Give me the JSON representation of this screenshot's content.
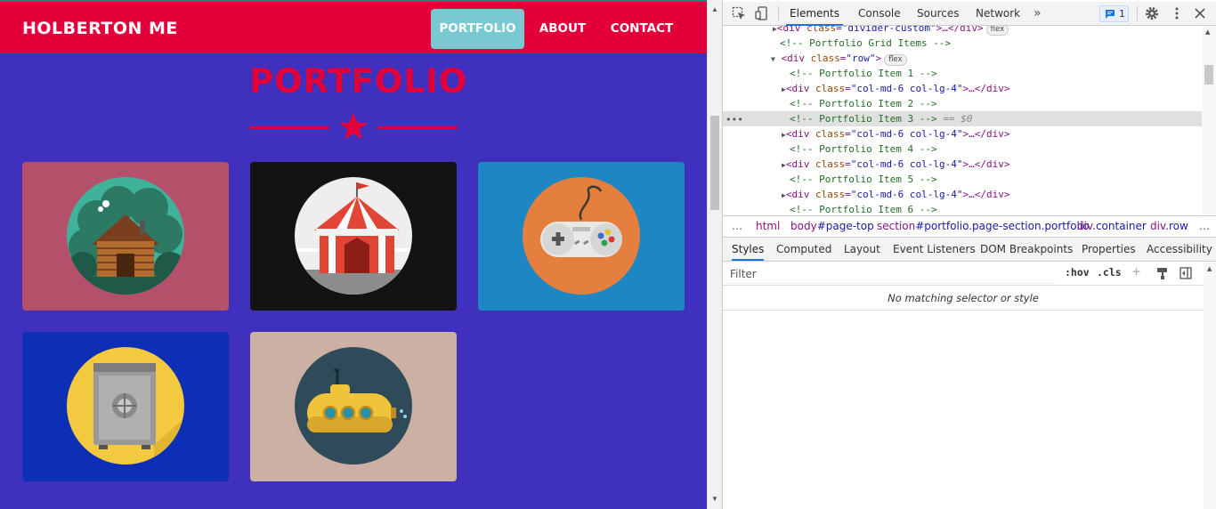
{
  "page": {
    "brand": "HOLBERTON ME",
    "nav": {
      "portfolio": "PORTFOLIO",
      "about": "ABOUT",
      "contact": "CONTACT"
    },
    "section_heading": "PORTFOLIO",
    "portfolio_items": [
      {
        "icon": "cabin-icon",
        "bg": "#b5506a"
      },
      {
        "icon": "circus-tent-icon",
        "bg": "#151212"
      },
      {
        "icon": "game-controller-icon",
        "bg": "#1f86c4"
      },
      {
        "icon": "safe-icon",
        "bg": "#0c2fb5"
      },
      {
        "icon": "submarine-icon",
        "bg": "#ccb0a3"
      }
    ],
    "colors": {
      "primary": "#e3003a",
      "page_bg": "#3f31be",
      "active_nav": "#79c9d3"
    }
  },
  "devtools": {
    "tabs": {
      "elements": "Elements",
      "console": "Console",
      "sources": "Sources",
      "network": "Network",
      "more": "»"
    },
    "issues_count": "1",
    "dom": {
      "l0": {
        "open": "<div ",
        "attr": "class",
        "val": "\"divider-custom\"",
        "rest": ">…</div>",
        "badge": "flex"
      },
      "l1": "<!-- Portfolio Grid Items -->",
      "l2": {
        "open": "<div ",
        "attr": "class",
        "val": "\"row\"",
        "rest": ">",
        "badge": "flex"
      },
      "l3": "<!-- Portfolio Item 1 -->",
      "l4": {
        "open": "<div ",
        "attr": "class",
        "val": "\"col-md-6 col-lg-4\"",
        "rest": ">…</div>"
      },
      "l5": "<!-- Portfolio Item 2 -->",
      "l6": "<!-- Portfolio Item 3 -->",
      "l6_ref": "== $0",
      "l7": {
        "open": "<div ",
        "attr": "class",
        "val": "\"col-md-6 col-lg-4\"",
        "rest": ">…</div>"
      },
      "l8": "<!-- Portfolio Item 4 -->",
      "l9": {
        "open": "<div ",
        "attr": "class",
        "val": "\"col-md-6 col-lg-4\"",
        "rest": ">…</div>"
      },
      "l10": "<!-- Portfolio Item 5 -->",
      "l11": {
        "open": "<div ",
        "attr": "class",
        "val": "\"col-md-6 col-lg-4\"",
        "rest": ">…</div>"
      },
      "l12": "<!-- Portfolio Item 6 -->"
    },
    "breadcrumb": {
      "lead": "…",
      "c1_tag": "html",
      "c2_tag": "body",
      "c2_rest": "#page-top",
      "c3_tag": "section",
      "c3_rest": "#portfolio.page-section.portfolio",
      "c4_tag": "div",
      "c4_rest": ".container",
      "c5_tag": "div",
      "c5_rest": ".row",
      "trail": "…"
    },
    "styles_tabs": {
      "styles": "Styles",
      "computed": "Computed",
      "layout": "Layout",
      "listeners": "Event Listeners",
      "dom_breakpoints": "DOM Breakpoints",
      "properties": "Properties",
      "accessibility": "Accessibility"
    },
    "filter": {
      "placeholder": "Filter",
      "hov": ":hov",
      "cls": ".cls",
      "plus": "+"
    },
    "no_match": "No matching selector or style"
  }
}
